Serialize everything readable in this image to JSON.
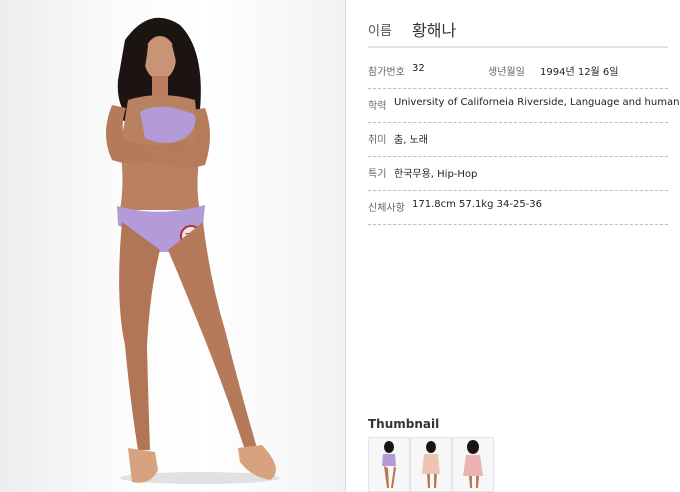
{
  "profile": {
    "name_label": "이름",
    "name": "황해나",
    "entry_no_label": "참가번호",
    "entry_no": "32",
    "birth_label": "생년월일",
    "birth": "1994년 12월 6일",
    "education_label": "학력",
    "education": "University of Californeia Riverside, Language and humanitie",
    "hobby_label": "취미",
    "hobby": "춤, 노래",
    "skill_label": "특기",
    "skill": "한국무용, Hip-Hop",
    "body_label": "신체사항",
    "body": "171.8cm   57.1kg   34-25-36"
  },
  "photo": {
    "badge": "32"
  },
  "thumbnails": {
    "title": "Thumbnail"
  },
  "colors": {
    "swimsuit": "#b39ad8",
    "skin": "#b9805f",
    "hair": "#1c1412"
  }
}
